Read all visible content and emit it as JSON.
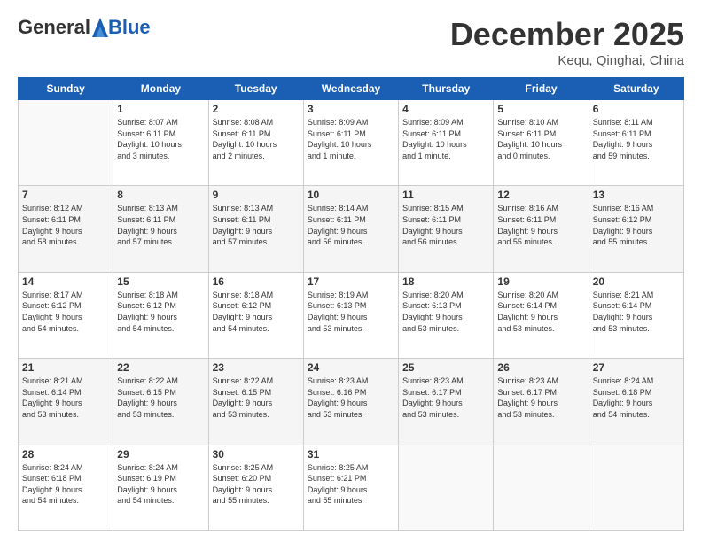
{
  "header": {
    "logo_general": "General",
    "logo_blue": "Blue",
    "month": "December 2025",
    "location": "Kequ, Qinghai, China"
  },
  "days_of_week": [
    "Sunday",
    "Monday",
    "Tuesday",
    "Wednesday",
    "Thursday",
    "Friday",
    "Saturday"
  ],
  "weeks": [
    {
      "shade": false,
      "days": [
        {
          "num": "",
          "info": ""
        },
        {
          "num": "1",
          "info": "Sunrise: 8:07 AM\nSunset: 6:11 PM\nDaylight: 10 hours\nand 3 minutes."
        },
        {
          "num": "2",
          "info": "Sunrise: 8:08 AM\nSunset: 6:11 PM\nDaylight: 10 hours\nand 2 minutes."
        },
        {
          "num": "3",
          "info": "Sunrise: 8:09 AM\nSunset: 6:11 PM\nDaylight: 10 hours\nand 1 minute."
        },
        {
          "num": "4",
          "info": "Sunrise: 8:09 AM\nSunset: 6:11 PM\nDaylight: 10 hours\nand 1 minute."
        },
        {
          "num": "5",
          "info": "Sunrise: 8:10 AM\nSunset: 6:11 PM\nDaylight: 10 hours\nand 0 minutes."
        },
        {
          "num": "6",
          "info": "Sunrise: 8:11 AM\nSunset: 6:11 PM\nDaylight: 9 hours\nand 59 minutes."
        }
      ]
    },
    {
      "shade": true,
      "days": [
        {
          "num": "7",
          "info": "Sunrise: 8:12 AM\nSunset: 6:11 PM\nDaylight: 9 hours\nand 58 minutes."
        },
        {
          "num": "8",
          "info": "Sunrise: 8:13 AM\nSunset: 6:11 PM\nDaylight: 9 hours\nand 57 minutes."
        },
        {
          "num": "9",
          "info": "Sunrise: 8:13 AM\nSunset: 6:11 PM\nDaylight: 9 hours\nand 57 minutes."
        },
        {
          "num": "10",
          "info": "Sunrise: 8:14 AM\nSunset: 6:11 PM\nDaylight: 9 hours\nand 56 minutes."
        },
        {
          "num": "11",
          "info": "Sunrise: 8:15 AM\nSunset: 6:11 PM\nDaylight: 9 hours\nand 56 minutes."
        },
        {
          "num": "12",
          "info": "Sunrise: 8:16 AM\nSunset: 6:11 PM\nDaylight: 9 hours\nand 55 minutes."
        },
        {
          "num": "13",
          "info": "Sunrise: 8:16 AM\nSunset: 6:12 PM\nDaylight: 9 hours\nand 55 minutes."
        }
      ]
    },
    {
      "shade": false,
      "days": [
        {
          "num": "14",
          "info": "Sunrise: 8:17 AM\nSunset: 6:12 PM\nDaylight: 9 hours\nand 54 minutes."
        },
        {
          "num": "15",
          "info": "Sunrise: 8:18 AM\nSunset: 6:12 PM\nDaylight: 9 hours\nand 54 minutes."
        },
        {
          "num": "16",
          "info": "Sunrise: 8:18 AM\nSunset: 6:12 PM\nDaylight: 9 hours\nand 54 minutes."
        },
        {
          "num": "17",
          "info": "Sunrise: 8:19 AM\nSunset: 6:13 PM\nDaylight: 9 hours\nand 53 minutes."
        },
        {
          "num": "18",
          "info": "Sunrise: 8:20 AM\nSunset: 6:13 PM\nDaylight: 9 hours\nand 53 minutes."
        },
        {
          "num": "19",
          "info": "Sunrise: 8:20 AM\nSunset: 6:14 PM\nDaylight: 9 hours\nand 53 minutes."
        },
        {
          "num": "20",
          "info": "Sunrise: 8:21 AM\nSunset: 6:14 PM\nDaylight: 9 hours\nand 53 minutes."
        }
      ]
    },
    {
      "shade": true,
      "days": [
        {
          "num": "21",
          "info": "Sunrise: 8:21 AM\nSunset: 6:14 PM\nDaylight: 9 hours\nand 53 minutes."
        },
        {
          "num": "22",
          "info": "Sunrise: 8:22 AM\nSunset: 6:15 PM\nDaylight: 9 hours\nand 53 minutes."
        },
        {
          "num": "23",
          "info": "Sunrise: 8:22 AM\nSunset: 6:15 PM\nDaylight: 9 hours\nand 53 minutes."
        },
        {
          "num": "24",
          "info": "Sunrise: 8:23 AM\nSunset: 6:16 PM\nDaylight: 9 hours\nand 53 minutes."
        },
        {
          "num": "25",
          "info": "Sunrise: 8:23 AM\nSunset: 6:17 PM\nDaylight: 9 hours\nand 53 minutes."
        },
        {
          "num": "26",
          "info": "Sunrise: 8:23 AM\nSunset: 6:17 PM\nDaylight: 9 hours\nand 53 minutes."
        },
        {
          "num": "27",
          "info": "Sunrise: 8:24 AM\nSunset: 6:18 PM\nDaylight: 9 hours\nand 54 minutes."
        }
      ]
    },
    {
      "shade": false,
      "days": [
        {
          "num": "28",
          "info": "Sunrise: 8:24 AM\nSunset: 6:18 PM\nDaylight: 9 hours\nand 54 minutes."
        },
        {
          "num": "29",
          "info": "Sunrise: 8:24 AM\nSunset: 6:19 PM\nDaylight: 9 hours\nand 54 minutes."
        },
        {
          "num": "30",
          "info": "Sunrise: 8:25 AM\nSunset: 6:20 PM\nDaylight: 9 hours\nand 55 minutes."
        },
        {
          "num": "31",
          "info": "Sunrise: 8:25 AM\nSunset: 6:21 PM\nDaylight: 9 hours\nand 55 minutes."
        },
        {
          "num": "",
          "info": ""
        },
        {
          "num": "",
          "info": ""
        },
        {
          "num": "",
          "info": ""
        }
      ]
    }
  ]
}
